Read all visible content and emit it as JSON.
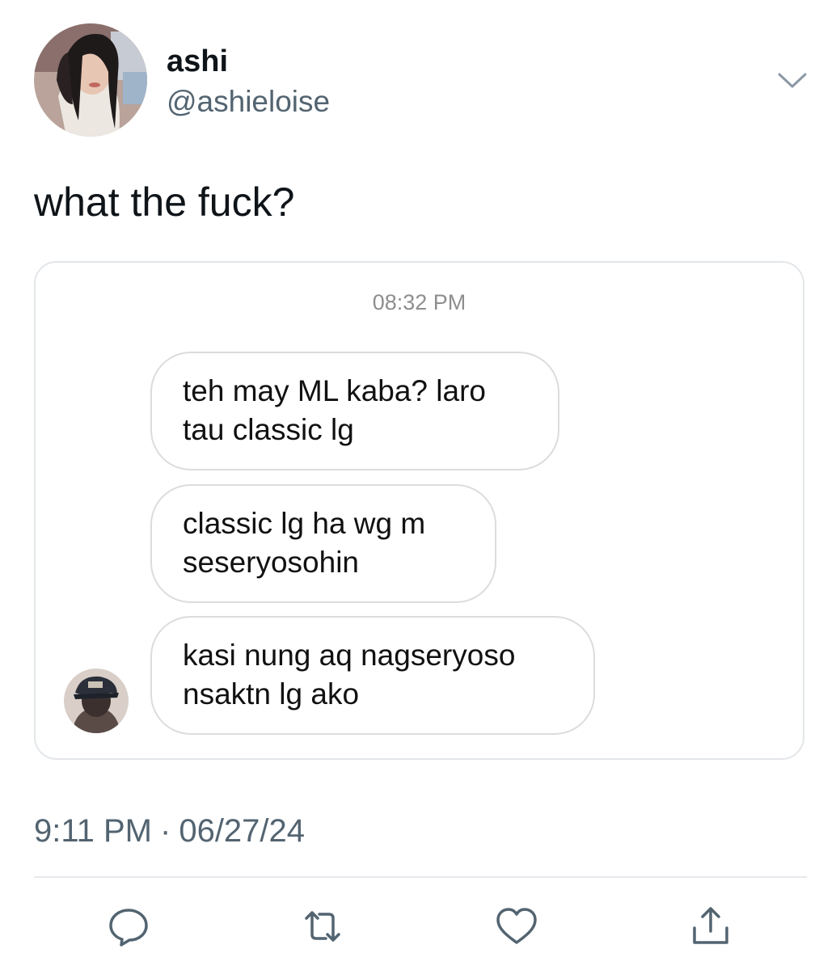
{
  "author": {
    "display_name": "ashi",
    "handle": "@ashieloise"
  },
  "tweet": {
    "text": "what the fuck?",
    "time": "9:11 PM",
    "separator": "·",
    "date": "06/27/24"
  },
  "media": {
    "chat_time": "08:32 PM",
    "messages": [
      {
        "line1": "teh may ML kaba? laro",
        "line2": "tau classic lg"
      },
      {
        "line1": "classic lg ha wg m",
        "line2": "seseryosohin"
      },
      {
        "line1": "kasi nung aq nagseryoso",
        "line2": "nsaktn lg ako"
      }
    ]
  },
  "icons": {
    "more": "chevron-down-icon",
    "reply": "reply-icon",
    "retweet": "retweet-icon",
    "like": "heart-icon",
    "share": "share-icon"
  },
  "colors": {
    "text_primary": "#0f1419",
    "text_secondary": "#536471",
    "bubble_border": "#dcdcdc",
    "card_border": "#e3e6e9"
  }
}
